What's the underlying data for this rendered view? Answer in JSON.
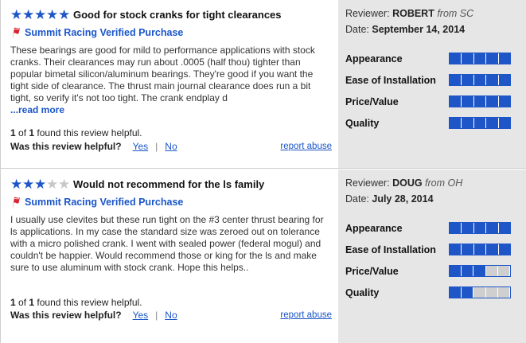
{
  "reviews": [
    {
      "rating": 5,
      "max_rating": 5,
      "title": "Good for stock cranks for tight clearances",
      "verified_label": "Summit Racing Verified Purchase",
      "body": "These bearings are good for mild to performance applications with stock cranks. Their clearances may run about .0005 (half thou) tighter than popular bimetal silicon/aluminum bearings. They're good if you want the tight side of clearance. The thrust main journal clearance does run a bit tight, so verify it's not too tight. The crank endplay d",
      "read_more": "...read more",
      "helpful_count": "1",
      "helpful_total": "1",
      "helpful_text": "found this review helpful.",
      "helpful_of": "of",
      "helpful_question": "Was this review helpful?",
      "yes_label": "Yes",
      "separator": "|",
      "no_label": "No",
      "report_label": "report abuse",
      "reviewer_label": "Reviewer:",
      "reviewer_name": "ROBERT",
      "reviewer_from": "from SC",
      "date_label": "Date:",
      "date": "September 14, 2014",
      "ratings": [
        {
          "label": "Appearance",
          "value": 5
        },
        {
          "label": "Ease of Installation",
          "value": 5
        },
        {
          "label": "Price/Value",
          "value": 5
        },
        {
          "label": "Quality",
          "value": 5
        }
      ]
    },
    {
      "rating": 3,
      "max_rating": 5,
      "title": "Would not recommend for the ls family",
      "verified_label": "Summit Racing Verified Purchase",
      "body": "I usually use clevites but these run tight on the #3 center thrust bearing for ls applications. In my case the standard size was zeroed out on tolerance with a micro polished crank. I went with sealed power (federal mogul) and couldn't be happier. Would recommend those or king for the ls and make sure to use aluminum with stock crank. Hope this helps..",
      "read_more": "",
      "helpful_count": "1",
      "helpful_total": "1",
      "helpful_text": "found this review helpful.",
      "helpful_of": "of",
      "helpful_question": "Was this review helpful?",
      "yes_label": "Yes",
      "separator": "|",
      "no_label": "No",
      "report_label": "report abuse",
      "reviewer_label": "Reviewer:",
      "reviewer_name": "DOUG",
      "reviewer_from": "from OH",
      "date_label": "Date:",
      "date": "July 28, 2014",
      "ratings": [
        {
          "label": "Appearance",
          "value": 5
        },
        {
          "label": "Ease of Installation",
          "value": 5
        },
        {
          "label": "Price/Value",
          "value": 3
        },
        {
          "label": "Quality",
          "value": 2
        }
      ]
    }
  ],
  "colors": {
    "accent_blue": "#1e55c7",
    "link_blue": "#1a56c9",
    "flag_red": "#d9252f",
    "panel_gray": "#e6e6e6"
  },
  "icons": {
    "star": "star-icon",
    "verified": "summit-flag-icon"
  }
}
